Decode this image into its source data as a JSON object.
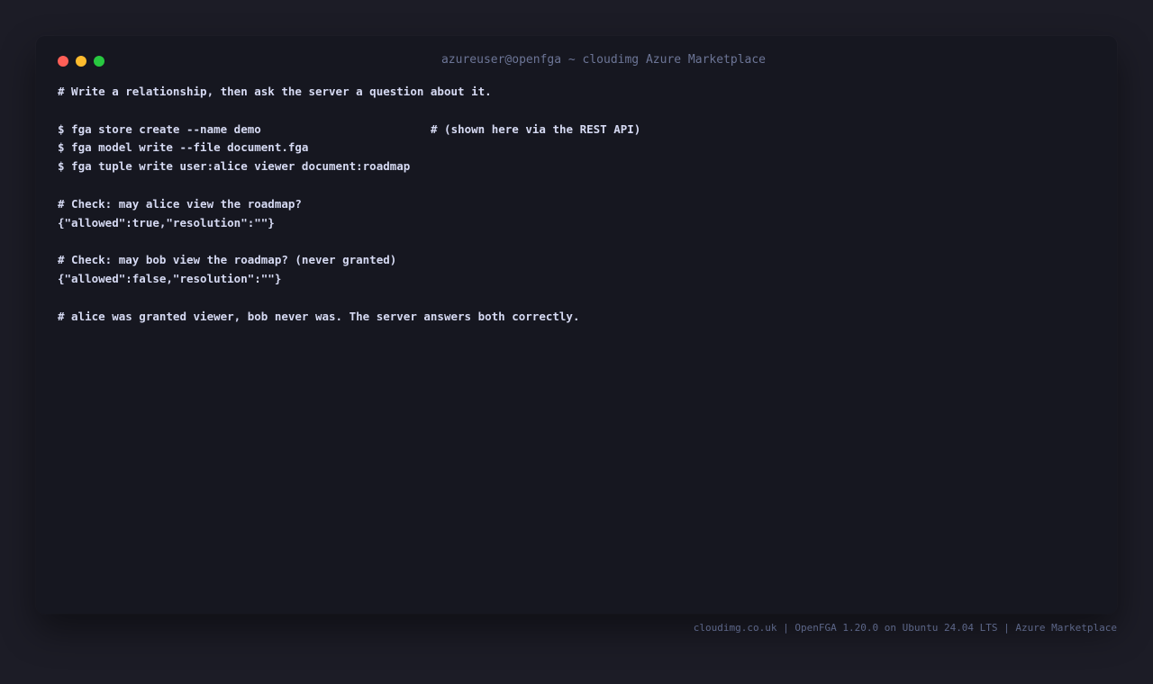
{
  "window": {
    "title": "azureuser@openfga ~ cloudimg Azure Marketplace"
  },
  "terminal": {
    "lines": [
      "# Write a relationship, then ask the server a question about it.",
      "",
      "$ fga store create --name demo",
      "$ fga model write --file document.fga",
      "$ fga tuple write user:alice viewer document:roadmap",
      "",
      "# Check: may alice view the roadmap?",
      "{\"allowed\":true,\"resolution\":\"\"}",
      "",
      "# Check: may bob view the roadmap? (never granted)",
      "{\"allowed\":false,\"resolution\":\"\"}",
      "",
      "# alice was granted viewer, bob never was. The server answers both correctly."
    ],
    "inline_comment": "# (shown here via the REST API)"
  },
  "footer": {
    "text": "cloudimg.co.uk | OpenFGA 1.20.0 on Ubuntu 24.04 LTS | Azure Marketplace"
  },
  "colors": {
    "background": "#1c1c26",
    "terminal_bg": "#161720",
    "text": "#d6daf3",
    "muted": "#6c7596",
    "close": "#ff5f57",
    "minimize": "#febc2e",
    "maximize": "#28c840"
  }
}
